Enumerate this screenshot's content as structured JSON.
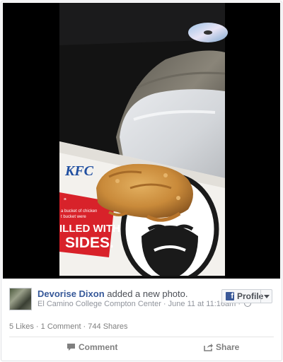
{
  "post": {
    "author": "Devorise Dixon",
    "action_text": "added a new photo.",
    "location": "El Camino College Compton Center",
    "timestamp": "June 11 at 11:16am",
    "separator": " · ",
    "trailing_dot": " ·"
  },
  "profile_button": {
    "logo": "f",
    "label": "Profile"
  },
  "photo": {
    "box_brand": "KFC",
    "box_text_lines": [
      "“",
      "a bucket of chicken",
      "t bucket were",
      "ILLED WITH",
      "SIDES."
    ],
    "colors": {
      "kfc_red": "#d8222a",
      "box_white": "#f3f1ed",
      "fried": "#c98a3a"
    }
  },
  "stats": {
    "likes": "5 Likes",
    "comments": "1 Comment",
    "shares": "744 Shares",
    "separator": " · "
  },
  "actions": {
    "comment_label": "Comment",
    "share_label": "Share",
    "comment_icon": "speech-bubble-icon",
    "share_icon": "share-arrow-icon"
  },
  "icons": {
    "privacy": "globe-icon",
    "dropdown": "chevron-down-icon"
  }
}
